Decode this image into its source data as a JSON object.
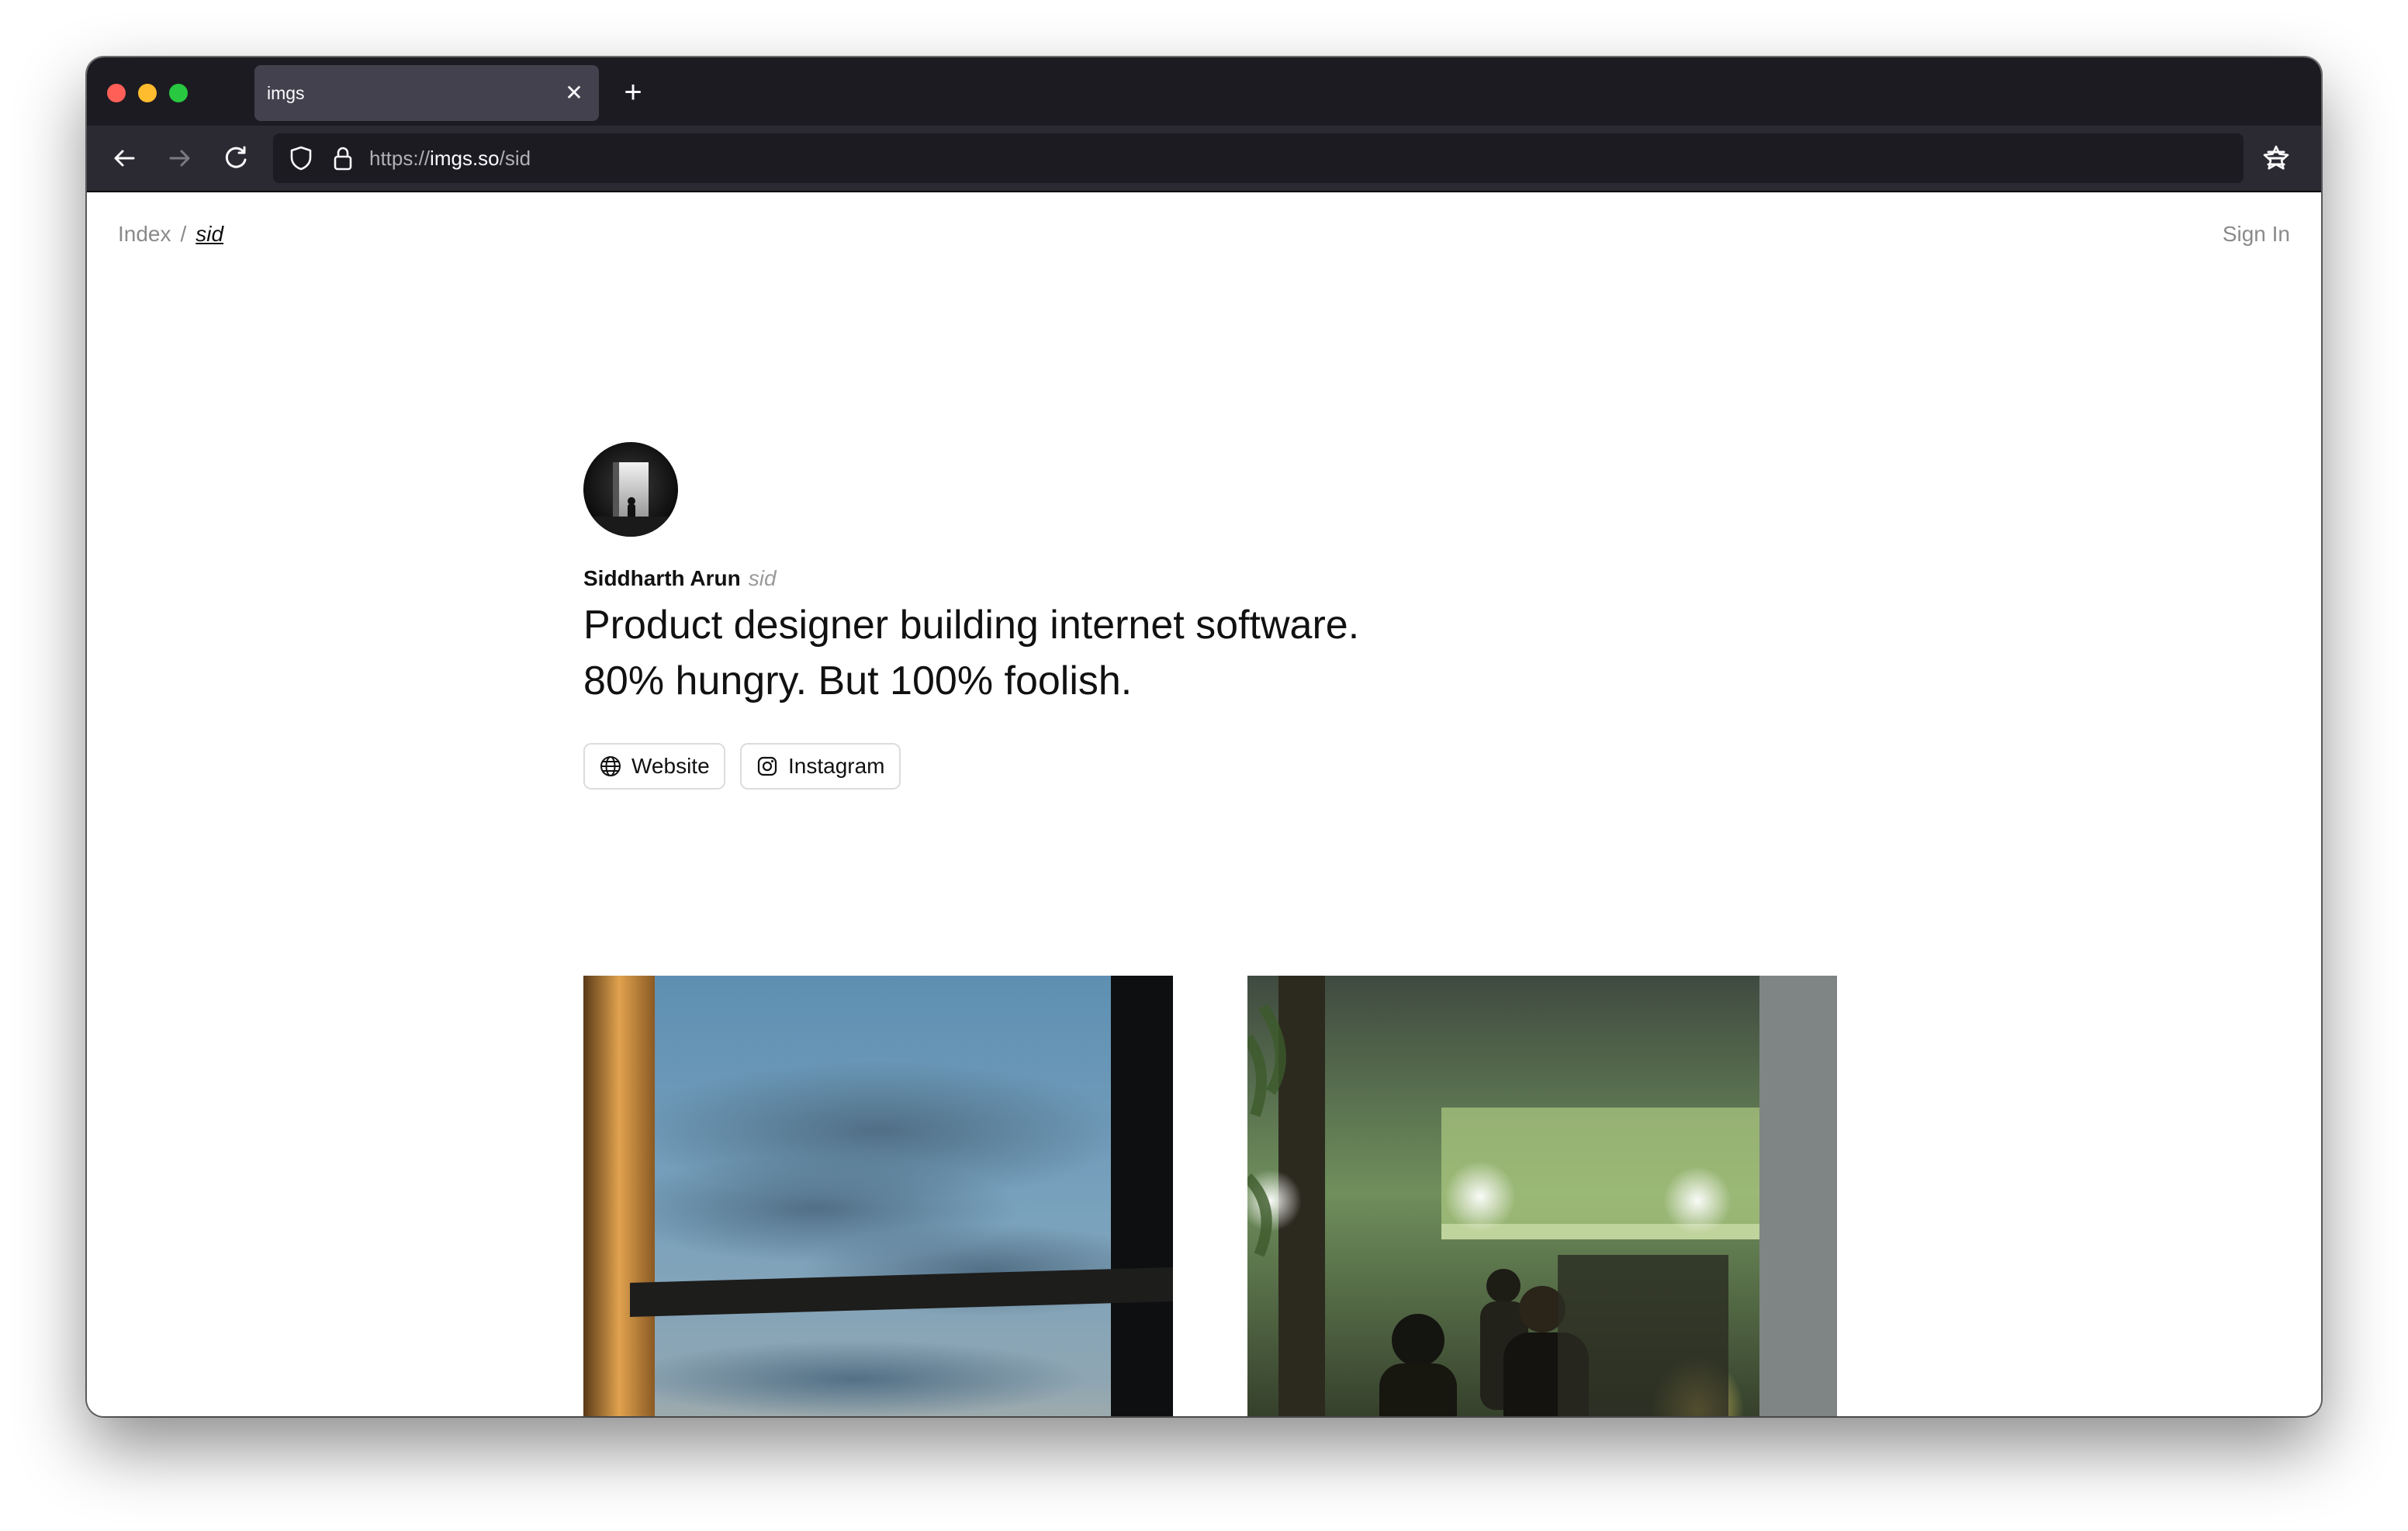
{
  "browser": {
    "tab_title": "imgs",
    "url_scheme": "https://",
    "url_host": "imgs.so",
    "url_path": "/sid"
  },
  "nav": {
    "index_label": "Index",
    "separator": "/",
    "current_label": "sid",
    "signin_label": "Sign In"
  },
  "profile": {
    "name": "Siddharth Arun",
    "handle": "sid",
    "bio": "Product designer building internet software. 80% hungry. But 100% foolish.",
    "links": [
      {
        "label": "Website",
        "icon": "globe-icon"
      },
      {
        "label": "Instagram",
        "icon": "instagram-icon"
      }
    ]
  },
  "gallery": {
    "photos": [
      {
        "name": "photo-window-sky"
      },
      {
        "name": "photo-cafe-interior"
      }
    ]
  },
  "colors": {
    "chrome_dark": "#1c1b22",
    "toolbar": "#2b2a33",
    "tab_active": "#42414d",
    "text_primary": "#111111",
    "text_muted": "#8a8a8a"
  }
}
